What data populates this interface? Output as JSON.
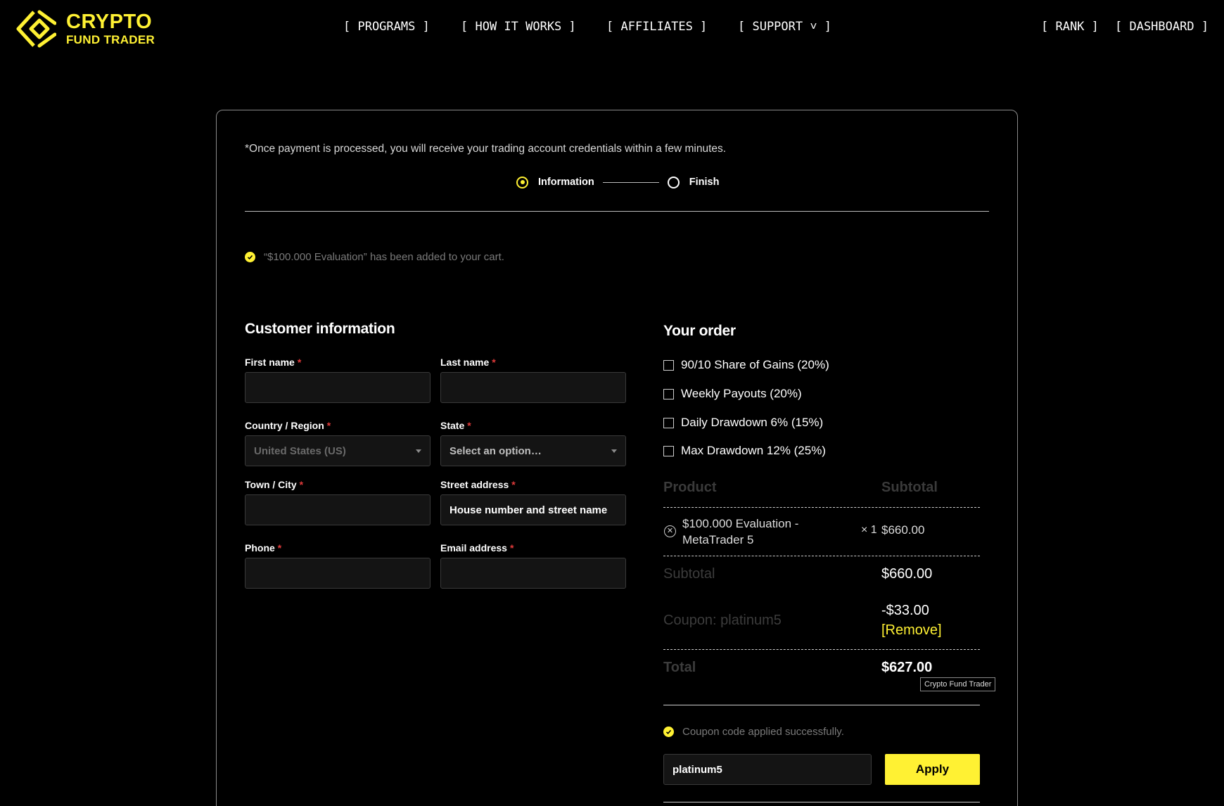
{
  "brand": {
    "line1": "CRYPTO",
    "line2": "FUND TRADER",
    "color": "#fff133"
  },
  "nav": {
    "programs": "[ PROGRAMS ]",
    "how_it_works": "[ HOW IT WORKS ]",
    "affiliates": "[ AFFILIATES ]",
    "support": "[ SUPPORT ˅ ]",
    "rank": "[ RANK ]",
    "dashboard": "[ DASHBOARD ]"
  },
  "checkout": {
    "notice": "*Once payment is processed, you will receive your trading account credentials within a few minutes.",
    "steps": [
      "Information",
      "Finish"
    ],
    "cart_message": "“$100.000 Evaluation” has been added to your cart."
  },
  "customer": {
    "title": "Customer information",
    "first_name_label": "First name",
    "last_name_label": "Last name",
    "country_label": "Country / Region",
    "country_value": "United States (US)",
    "state_label": "State",
    "state_value": "Select an option…",
    "city_label": "Town / City",
    "street_label": "Street address",
    "street_value": "House number and street name",
    "phone_label": "Phone",
    "email_label": "Email address",
    "required_mark": "*"
  },
  "order": {
    "title": "Your order",
    "addons": [
      "90/10 Share of Gains (20%)",
      "Weekly Payouts (20%)",
      "Daily Drawdown 6% (15%)",
      "Max Drawdown 12% (25%)"
    ],
    "col_product": "Product",
    "col_subtotal": "Subtotal",
    "product_name": "$100.000 Evaluation - MetaTrader 5",
    "product_qty": "× 1",
    "product_price": "$660.00",
    "subtotal_label": "Subtotal",
    "subtotal_value": "$660.00",
    "coupon_label": "Coupon: platinum5",
    "coupon_value": "-$33.00",
    "coupon_remove": "[Remove]",
    "total_label": "Total",
    "total_value": "$627.00",
    "tooltip": "Crypto Fund Trader",
    "coupon_success": "Coupon code applied successfully.",
    "coupon_code": "platinum5",
    "apply_label": "Apply"
  }
}
